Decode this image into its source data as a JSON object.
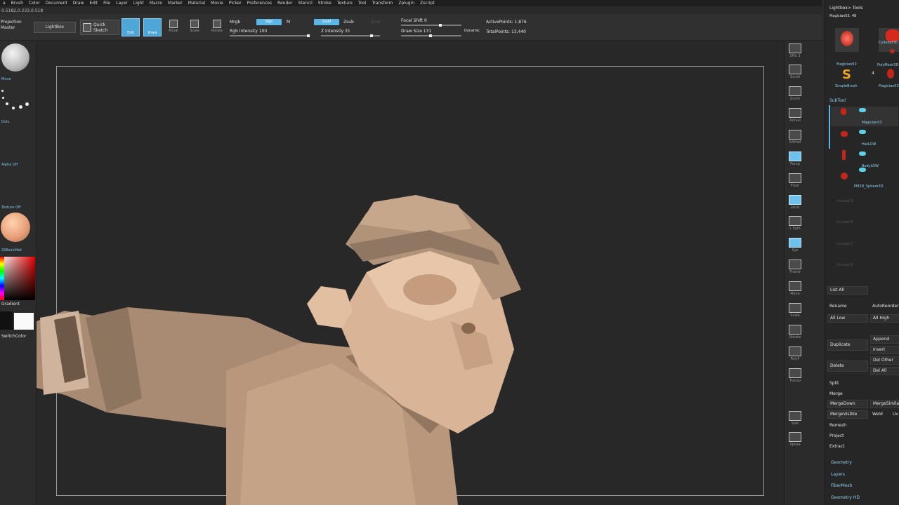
{
  "menu": [
    "a",
    "Brush",
    "Color",
    "Document",
    "Draw",
    "Edit",
    "File",
    "Layer",
    "Light",
    "Macro",
    "Marker",
    "Material",
    "Movie",
    "Picker",
    "Preferences",
    "Render",
    "Stencil",
    "Stroke",
    "Texture",
    "Tool",
    "Transform",
    "Zplugin",
    "Zscript"
  ],
  "coords": "0.5182,0.233,0.518",
  "shelf": {
    "projection_master": "Projection Master",
    "lightbox": "LightBox",
    "quick_sketch": "Quick Sketch",
    "edit": "Edit",
    "draw": "Draw",
    "move": "Move",
    "scale": "Scale",
    "rotate": "Rotate",
    "mrgb": "Mrgb",
    "rgb": "Rgb",
    "m": "M",
    "zadd": "Zadd",
    "zsub": "Zsub",
    "zcut": "Zcut",
    "rgb_intensity": "Rgb Intensity 100",
    "z_intensity": "Z Intensity 31",
    "focal_shift": "Focal Shift 0",
    "draw_size": "Draw Size 131",
    "dynamic": "Dynamic",
    "active_points": "ActivePoints: 1,876",
    "total_points": "TotalPoints: 13,440"
  },
  "left_tray": {
    "brush_label": "Move",
    "stroke_label": "Dots",
    "alpha_label": "Alpha Off",
    "texture_label": "Texture Off",
    "material_label": "2SBasicMat",
    "gradient_label": "Gradient",
    "switch_color": "SwitchColor"
  },
  "right_shelf": [
    "SPix 3",
    "Scroll",
    "Zoom",
    "Actual",
    "AAHalf",
    "Persp",
    "Floor",
    "Local",
    "L.Sym",
    "Xyz",
    "Frame",
    "Move",
    "Scale",
    "Rotate",
    "PolyF",
    "Transp",
    "Solo",
    "Xpose"
  ],
  "lightbox_tools": {
    "title": "Lightbox> Tools",
    "subtitle": "Magician03. 48",
    "items": [
      "Magician03",
      "Cylinder3D",
      "PolyMesh3D",
      "SimpleBrush",
      "Magician03"
    ],
    "brush_count": "4"
  },
  "subtool": {
    "title": "SubTool",
    "items": [
      "Magician03",
      "HatLOW",
      "BodyLOW",
      "PM3D_Sphere3D"
    ],
    "empty": [
      "Unused 5",
      "Unused 6",
      "Unused 7",
      "Unused 8"
    ]
  },
  "actions": {
    "list_all": "List All",
    "rename": "Rename",
    "auto_reorder": "AutoReorder",
    "all_low": "All Low",
    "all_high": "All High",
    "duplicate": "Duplicate",
    "append": "Append",
    "insert": "Insert",
    "delete": "Delete",
    "del_other": "Del Other",
    "del_all": "Del All",
    "split": "Split",
    "merge": "Merge",
    "merge_down": "MergeDown",
    "merge_similar": "MergeSimilar",
    "merge_visible": "MergeVisible",
    "weld": "Weld",
    "uv": "Uv",
    "remesh": "Remesh",
    "project": "Project",
    "extract": "Extract"
  },
  "sections": [
    "Geometry",
    "Layers",
    "FiberMesh",
    "Geometry HD"
  ],
  "colors": {
    "accent": "#5bb6e6",
    "viewport_bg": "#282828",
    "model_skin": "#c9a488"
  }
}
